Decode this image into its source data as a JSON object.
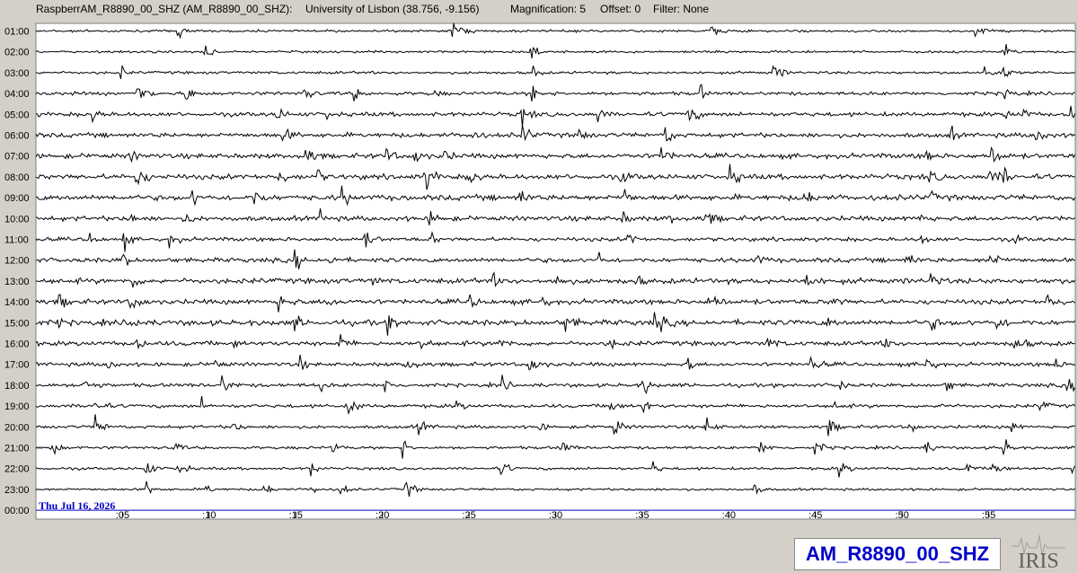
{
  "header": {
    "station_desc": "RaspberrAM_R8890_00_SHZ (AM_R8890_00_SHZ):",
    "location": "University of Lisbon (38.756, -9.156)",
    "magnification": "Magnification: 5",
    "offset": "Offset: 0",
    "filter": "Filter: None"
  },
  "date_label": "Thu Jul 16, 2026",
  "station_label": "AM_R8890_00_SHZ",
  "logo_text": "IRIS",
  "colors": {
    "background": "#d4d0c8",
    "plot_bg": "#ffffff",
    "trace": "#000000",
    "current_line": "#0000c8",
    "date_text": "#0000c8"
  },
  "chart_data": {
    "type": "line",
    "title": "",
    "xlabel": "",
    "ylabel": "",
    "x_unit": "minutes",
    "xlim": [
      0,
      60
    ],
    "x_ticks": [
      {
        "value": 5,
        "label": ":05"
      },
      {
        "value": 10,
        "label": ":10"
      },
      {
        "value": 15,
        "label": ":15"
      },
      {
        "value": 20,
        "label": ":20"
      },
      {
        "value": 25,
        "label": ":25"
      },
      {
        "value": 30,
        "label": ":30"
      },
      {
        "value": 35,
        "label": ":35"
      },
      {
        "value": 40,
        "label": ":40"
      },
      {
        "value": 45,
        "label": ":45"
      },
      {
        "value": 50,
        "label": ":50"
      },
      {
        "value": 55,
        "label": ":55"
      }
    ],
    "rows": [
      {
        "label": "01:00",
        "noise": 0.35,
        "events": [
          8.2,
          24.1,
          39.0,
          54.3
        ]
      },
      {
        "label": "02:00",
        "noise": 0.3,
        "events": [
          9.8,
          28.6,
          56.0
        ]
      },
      {
        "label": "03:00",
        "noise": 0.45,
        "events": [
          5.0,
          28.8,
          42.6,
          54.8,
          55.9
        ]
      },
      {
        "label": "04:00",
        "noise": 0.7,
        "events": [
          5.9,
          8.7,
          15.5,
          18.4,
          22.9,
          28.7,
          38.4,
          56.0
        ]
      },
      {
        "label": "05:00",
        "noise": 0.9,
        "events": [
          3.3,
          13.9,
          16.8,
          28.1,
          32.5,
          37.6,
          56.1,
          57.0,
          59.8
        ]
      },
      {
        "label": "06:00",
        "noise": 1.0,
        "events": [
          14.2,
          25.3,
          28.1,
          31.3,
          36.4,
          52.8,
          57.8
        ]
      },
      {
        "label": "07:00",
        "noise": 1.1,
        "events": [
          5.5,
          15.6,
          20.3,
          21.9,
          23.6,
          36.1,
          51.3,
          55.2
        ]
      },
      {
        "label": "08:00",
        "noise": 1.2,
        "events": [
          5.8,
          14.1,
          16.3,
          22.5,
          25.0,
          33.8,
          40.1,
          51.6,
          55.0,
          55.9
        ]
      },
      {
        "label": "09:00",
        "noise": 1.3,
        "events": [
          9.1,
          12.7,
          17.7,
          27.9,
          34.0,
          44.3,
          51.6
        ]
      },
      {
        "label": "10:00",
        "noise": 1.1,
        "events": [
          5.5,
          8.7,
          16.5,
          22.8,
          33.9,
          36.6,
          38.7,
          51.0
        ]
      },
      {
        "label": "11:00",
        "noise": 0.8,
        "events": [
          3.2,
          5.1,
          7.8,
          18.9,
          22.9,
          34.2,
          51.1,
          56.6
        ]
      },
      {
        "label": "12:00",
        "noise": 1.0,
        "events": [
          5.0,
          15.0,
          17.0,
          32.5,
          41.5,
          50.3,
          55.1
        ]
      },
      {
        "label": "13:00",
        "noise": 1.2,
        "events": [
          5.7,
          19.4,
          26.4,
          30.1,
          34.7,
          44.5,
          51.7
        ]
      },
      {
        "label": "14:00",
        "noise": 1.1,
        "events": [
          1.4,
          5.5,
          14.1,
          16.7,
          25.1,
          29.3,
          38.9,
          46.0,
          58.4
        ]
      },
      {
        "label": "15:00",
        "noise": 1.3,
        "events": [
          1.2,
          5.6,
          15.0,
          20.4,
          30.6,
          35.8,
          45.7,
          51.7,
          55.5
        ]
      },
      {
        "label": "16:00",
        "noise": 1.0,
        "events": [
          5.6,
          11.4,
          17.6,
          22.3,
          26.8,
          33.1,
          42.3,
          49.1,
          56.5
        ]
      },
      {
        "label": "17:00",
        "noise": 0.8,
        "events": [
          4.2,
          10.4,
          15.2,
          21.3,
          28.5,
          37.7,
          44.8,
          51.3,
          58.9
        ]
      },
      {
        "label": "18:00",
        "noise": 0.75,
        "events": [
          2.8,
          10.8,
          16.4,
          20.2,
          27.0,
          35.1,
          46.5,
          52.6,
          59.6
        ]
      },
      {
        "label": "19:00",
        "noise": 0.7,
        "events": [
          3.4,
          9.6,
          18.1,
          24.3,
          33.2,
          35.1,
          46.2,
          52.3,
          58.0
        ]
      },
      {
        "label": "20:00",
        "noise": 0.6,
        "events": [
          3.5,
          11.4,
          22.1,
          29.1,
          33.4,
          38.7,
          45.8,
          50.5,
          56.4
        ]
      },
      {
        "label": "21:00",
        "noise": 0.5,
        "events": [
          0.9,
          8.0,
          17.2,
          21.2,
          30.3,
          41.8,
          45.0,
          51.3,
          55.9
        ]
      },
      {
        "label": "22:00",
        "noise": 0.45,
        "events": [
          6.4,
          8.2,
          15.9,
          26.9,
          35.7,
          46.4,
          53.8,
          55.3,
          59.9
        ]
      },
      {
        "label": "23:00",
        "noise": 0.35,
        "events": [
          6.4,
          9.9,
          13.2,
          15.9,
          17.6,
          21.4,
          41.5
        ]
      },
      {
        "label": "00:00",
        "noise": 0,
        "events": []
      }
    ],
    "current_row": "00:00",
    "grid": false
  }
}
